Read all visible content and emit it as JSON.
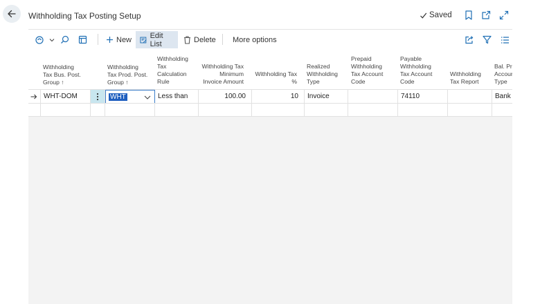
{
  "header": {
    "title": "Withholding Tax Posting Setup",
    "saved_label": "Saved",
    "icons": [
      "back-arrow-icon",
      "check-icon",
      "bookmark-icon",
      "open-new-window-icon",
      "expand-icon"
    ]
  },
  "actionbar": {
    "new_label": "New",
    "edit_list_label": "Edit List",
    "delete_label": "Delete",
    "more_options_label": "More options",
    "icons": [
      "copilot-icon",
      "search-icon",
      "page-icon",
      "share-icon",
      "filter-icon",
      "list-view-icon"
    ]
  },
  "grid": {
    "columns": [
      {
        "label_lines": [
          "Withholding",
          "Tax Bus. Post.",
          "Group ↑"
        ]
      },
      {
        "label_lines": [
          "Withholding",
          "Tax Prod. Post.",
          "Group ↑"
        ]
      },
      {
        "label_lines": [
          "Withholding",
          "Tax",
          "Calculation",
          "Rule"
        ]
      },
      {
        "label_lines": [
          "Withholding Tax",
          "Minimum",
          "Invoice Amount"
        ]
      },
      {
        "label_lines": [
          "Withholding Tax",
          "%"
        ]
      },
      {
        "label_lines": [
          "Realized",
          "Withholding",
          "Type"
        ]
      },
      {
        "label_lines": [
          "Prepaid",
          "Withholding",
          "Tax Account",
          "Code"
        ]
      },
      {
        "label_lines": [
          "Payable",
          "Withholding",
          "Tax Account",
          "Code"
        ]
      },
      {
        "label_lines": [
          "Withholding",
          "Tax Report"
        ]
      },
      {
        "label_lines": [
          "Bal. Pre",
          "Accoun",
          "Type"
        ]
      }
    ],
    "rows": [
      {
        "bus_post_group": "WHT-DOM",
        "prod_post_group": "WHT",
        "calc_rule": "Less than",
        "min_invoice_amount": "100.00",
        "tax_percent": "10",
        "realized_type": "Invoice",
        "prepaid_account": "",
        "payable_account": "74110",
        "tax_report": "",
        "bal_prepaid_type": "Bank A"
      }
    ]
  }
}
